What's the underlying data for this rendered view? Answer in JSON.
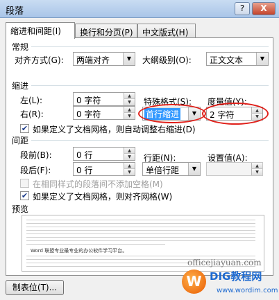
{
  "window": {
    "title": "段落",
    "help_glyph": "?",
    "close_glyph": "X"
  },
  "tabs": [
    "缩进和间距(I)",
    "换行和分页(P)",
    "中文版式(H)"
  ],
  "general": {
    "heading": "常规",
    "alignment_label": "对齐方式(G):",
    "alignment_value": "两端对齐",
    "outline_label": "大纲级别(O):",
    "outline_value": "正文文本"
  },
  "indent": {
    "heading": "缩进",
    "left_label": "左(L):",
    "left_value": "0 字符",
    "right_label": "右(R):",
    "right_value": "0 字符",
    "special_label": "特殊格式(S):",
    "special_value": "首行缩进",
    "measure_label": "度量值(Y):",
    "measure_value": "2 字符",
    "mirror_grid_label": "如果定义了文档网格，则自动调整右缩进(D)",
    "mirror_grid_checked": true
  },
  "spacing": {
    "heading": "间距",
    "before_label": "段前(B):",
    "before_value": "0 行",
    "after_label": "段后(F):",
    "after_value": "0 行",
    "line_label": "行距(N):",
    "line_value": "单倍行距",
    "setting_label": "设置值(A):",
    "setting_value": "",
    "no_space_label": "在相同样式的段落间不添加空格(M)",
    "no_space_checked": false,
    "snap_grid_label": "如果定义了文档网格，则对齐网格(W)",
    "snap_grid_checked": true
  },
  "preview": {
    "heading": "预览",
    "sample_text": "Word 联盟专业最专业的办公软件学习平台。"
  },
  "footer": {
    "tabs_button": "制表位(T)..."
  },
  "watermark": {
    "url": "officejiayuan.com",
    "logo_letter": "W",
    "brand": "DIG教程网",
    "site": "www.wordim.com"
  },
  "icons": {
    "dropdown": "triangle-down",
    "spin_up": "triangle-up",
    "spin_down": "triangle-down",
    "check": "checkmark"
  },
  "colors": {
    "highlight": "#3399ff",
    "annotation": "#e0201a",
    "titlebar": "#a9c5e8"
  }
}
